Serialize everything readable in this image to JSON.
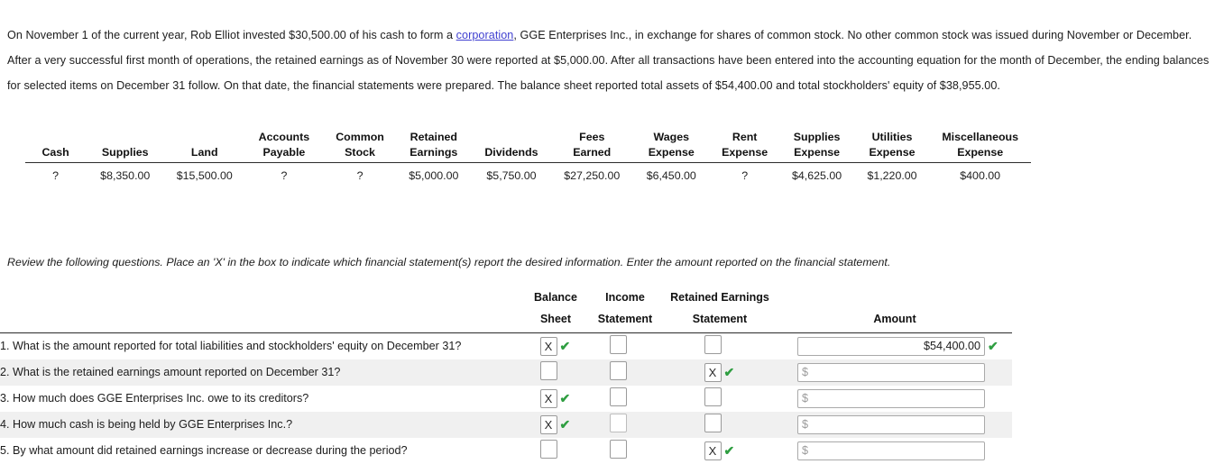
{
  "intro": {
    "part1": "On November 1 of the current year, Rob Elliot invested $30,500.00 of his cash to form a ",
    "link": "corporation",
    "part2": ", GGE Enterprises Inc., in exchange for shares of common stock. No other common stock was issued during November or December. After a very successful first month of operations, the retained earnings as of November 30 were reported at $5,000.00. After all transactions have been entered into the accounting equation for the month of December, the ending balances for selected items on December 31 follow. On that date, the financial statements were prepared. The balance sheet reported total assets of $54,400.00 and total stockholders' equity of $38,955.00.",
    "link_color": "#3f3fd0"
  },
  "equation_table": {
    "headers": [
      {
        "line1": "",
        "line2": "Cash"
      },
      {
        "line1": "",
        "line2": "Supplies"
      },
      {
        "line1": "",
        "line2": "Land"
      },
      {
        "line1": "Accounts",
        "line2": "Payable"
      },
      {
        "line1": "Common",
        "line2": "Stock"
      },
      {
        "line1": "Retained",
        "line2": "Earnings"
      },
      {
        "line1": "",
        "line2": "Dividends"
      },
      {
        "line1": "Fees",
        "line2": "Earned"
      },
      {
        "line1": "Wages",
        "line2": "Expense"
      },
      {
        "line1": "Rent",
        "line2": "Expense"
      },
      {
        "line1": "Supplies",
        "line2": "Expense"
      },
      {
        "line1": "Utilities",
        "line2": "Expense"
      },
      {
        "line1": "Miscellaneous",
        "line2": "Expense"
      }
    ],
    "values": [
      "?",
      "$8,350.00",
      "$15,500.00",
      "?",
      "?",
      "$5,000.00",
      "$5,750.00",
      "$27,250.00",
      "$6,450.00",
      "?",
      "$4,625.00",
      "$1,220.00",
      "$400.00"
    ]
  },
  "instructions": "Review the following questions. Place an 'X' in the box to indicate which financial statement(s) report the desired information. Enter the amount reported on the financial statement.",
  "questions_table": {
    "headers": {
      "question": "",
      "balance_sheet": {
        "line1": "Balance",
        "line2": "Sheet"
      },
      "income_statement": {
        "line1": "Income",
        "line2": "Statement"
      },
      "retained_earnings_statement": {
        "line1": "Retained Earnings",
        "line2": "Statement"
      },
      "amount": {
        "line1": "",
        "line2": "Amount"
      }
    },
    "rows": [
      {
        "question": "1. What is the amount reported for total liabilities and stockholders' equity on December 31?",
        "balance_sheet": "X",
        "balance_sheet_tick": "✔",
        "income_statement": "",
        "income_statement_tick": "",
        "retained_earnings": "",
        "retained_earnings_tick": "",
        "amount_value": "$54,400.00",
        "amount_placeholder": "$",
        "amount_tick": "✔"
      },
      {
        "question": "2. What is the retained earnings amount reported on December 31?",
        "balance_sheet": "",
        "balance_sheet_tick": "",
        "income_statement": "",
        "income_statement_tick": "",
        "retained_earnings": "X",
        "retained_earnings_tick": "✔",
        "amount_value": "",
        "amount_placeholder": "$",
        "amount_tick": ""
      },
      {
        "question": "3. How much does GGE Enterprises Inc. owe to its creditors?",
        "balance_sheet": "X",
        "balance_sheet_tick": "✔",
        "income_statement": "",
        "income_statement_tick": "",
        "retained_earnings": "",
        "retained_earnings_tick": "",
        "amount_value": "",
        "amount_placeholder": "$",
        "amount_tick": ""
      },
      {
        "question": "4. How much cash is being held by GGE Enterprises Inc.?",
        "balance_sheet": "X",
        "balance_sheet_tick": "✔",
        "income_statement": "",
        "income_statement_tick": "",
        "retained_earnings": "",
        "retained_earnings_tick": "",
        "amount_value": "",
        "amount_placeholder": "$",
        "amount_tick": ""
      },
      {
        "question": "5. By what amount did retained earnings increase or decrease during the period?",
        "balance_sheet": "",
        "balance_sheet_tick": "",
        "income_statement": "",
        "income_statement_tick": "",
        "retained_earnings": "X",
        "retained_earnings_tick": "✔",
        "amount_value": "",
        "amount_placeholder": "$",
        "amount_tick": ""
      }
    ]
  },
  "colors": {
    "tick_green": "#2f9e41",
    "link_blue": "#3f3fd0",
    "alt_row": "#f0f0f0"
  }
}
